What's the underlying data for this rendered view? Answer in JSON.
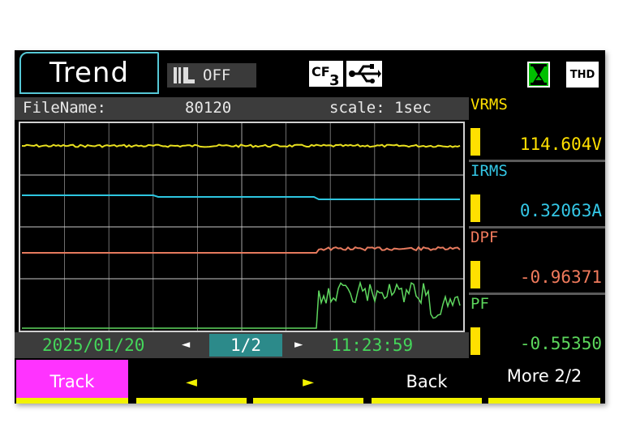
{
  "header": {
    "title": "Trend",
    "record_status": "OFF",
    "cf_label": "CF",
    "cf_sub": "3",
    "thd_label": "THD"
  },
  "info": {
    "filename_label": "FileName:",
    "filename_value": "80120",
    "scale": "scale: 1sec"
  },
  "nav": {
    "date": "2025/01/20",
    "page": "1/2",
    "time": "11:23:59"
  },
  "readouts": [
    {
      "label": "VRMS",
      "value": "114.604V",
      "color": "#ffe000"
    },
    {
      "label": "IRMS",
      "value": "0.32063A",
      "color": "#34c7e6"
    },
    {
      "label": "DPF",
      "value": "-0.96371",
      "color": "#f07a5c"
    },
    {
      "label": "PF",
      "value": "-0.55350",
      "color": "#5cd65c"
    }
  ],
  "softkeys": {
    "track": "Track",
    "left": "◄",
    "right": "►",
    "back": "Back",
    "more": "More 2/2"
  },
  "colors": {
    "vrms": "#e8df1e",
    "irms": "#2ec6e0",
    "dpf": "#e67a5e",
    "pf": "#5ed65e",
    "grid": "#8a8a8a",
    "track_key": "#ff33ff",
    "softkey_underline": "#f2f200"
  }
}
